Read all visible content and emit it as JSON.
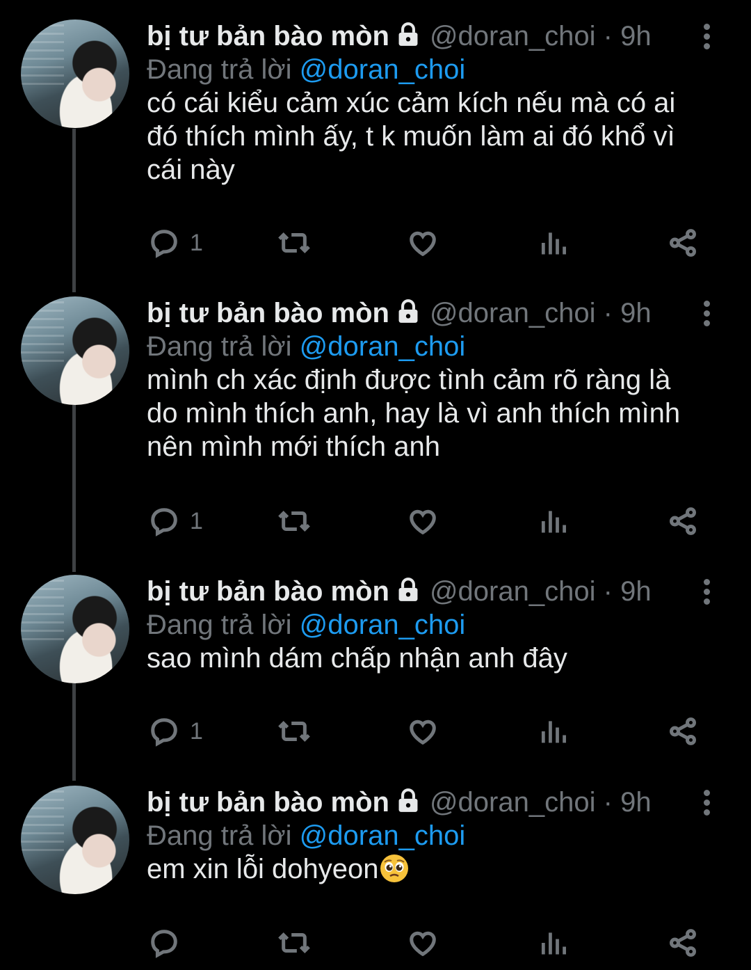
{
  "tweets": [
    {
      "name": "bị tư bản bào mòn",
      "handle": "@doran_choi",
      "dot": "·",
      "time": "9h",
      "reply_prefix": "Đang trả lời",
      "reply_to": "@doran_choi",
      "text_lines": [
        "có cái kiểu cảm xúc cảm kích nếu mà có ai",
        "đó thích mình ấy, t k muốn làm ai đó khổ vì",
        "cái này"
      ],
      "reply_count": "1"
    },
    {
      "name": "bị tư bản bào mòn",
      "handle": "@doran_choi",
      "dot": "·",
      "time": "9h",
      "reply_prefix": "Đang trả lời",
      "reply_to": "@doran_choi",
      "text_lines": [
        "mình ch xác định được tình cảm rõ ràng là",
        "do mình thích anh, hay là vì anh thích mình",
        "nên mình mới thích anh"
      ],
      "reply_count": "1"
    },
    {
      "name": "bị tư bản bào mòn",
      "handle": "@doran_choi",
      "dot": "·",
      "time": "9h",
      "reply_prefix": "Đang trả lời",
      "reply_to": "@doran_choi",
      "text_lines": [
        "sao mình dám chấp nhận anh đây"
      ],
      "reply_count": "1"
    },
    {
      "name": "bị tư bản bào mòn",
      "handle": "@doran_choi",
      "dot": "·",
      "time": "9h",
      "reply_prefix": "Đang trả lời",
      "reply_to": "@doran_choi",
      "text_lines": [
        "em xin lỗi dohyeon"
      ],
      "emoji": "pleading-face-emoji",
      "reply_count": ""
    }
  ],
  "icons": {
    "lock": "lock-icon",
    "more": "more-vertical-icon",
    "reply": "reply-bubble-icon",
    "retweet": "retweet-icon",
    "like": "heart-icon",
    "views": "analytics-bars-icon",
    "share": "share-icon"
  },
  "colors": {
    "background": "#000000",
    "text": "#e7e9ea",
    "muted": "#71767b",
    "link": "#1d9bf0",
    "thread_line": "#3e4144"
  }
}
